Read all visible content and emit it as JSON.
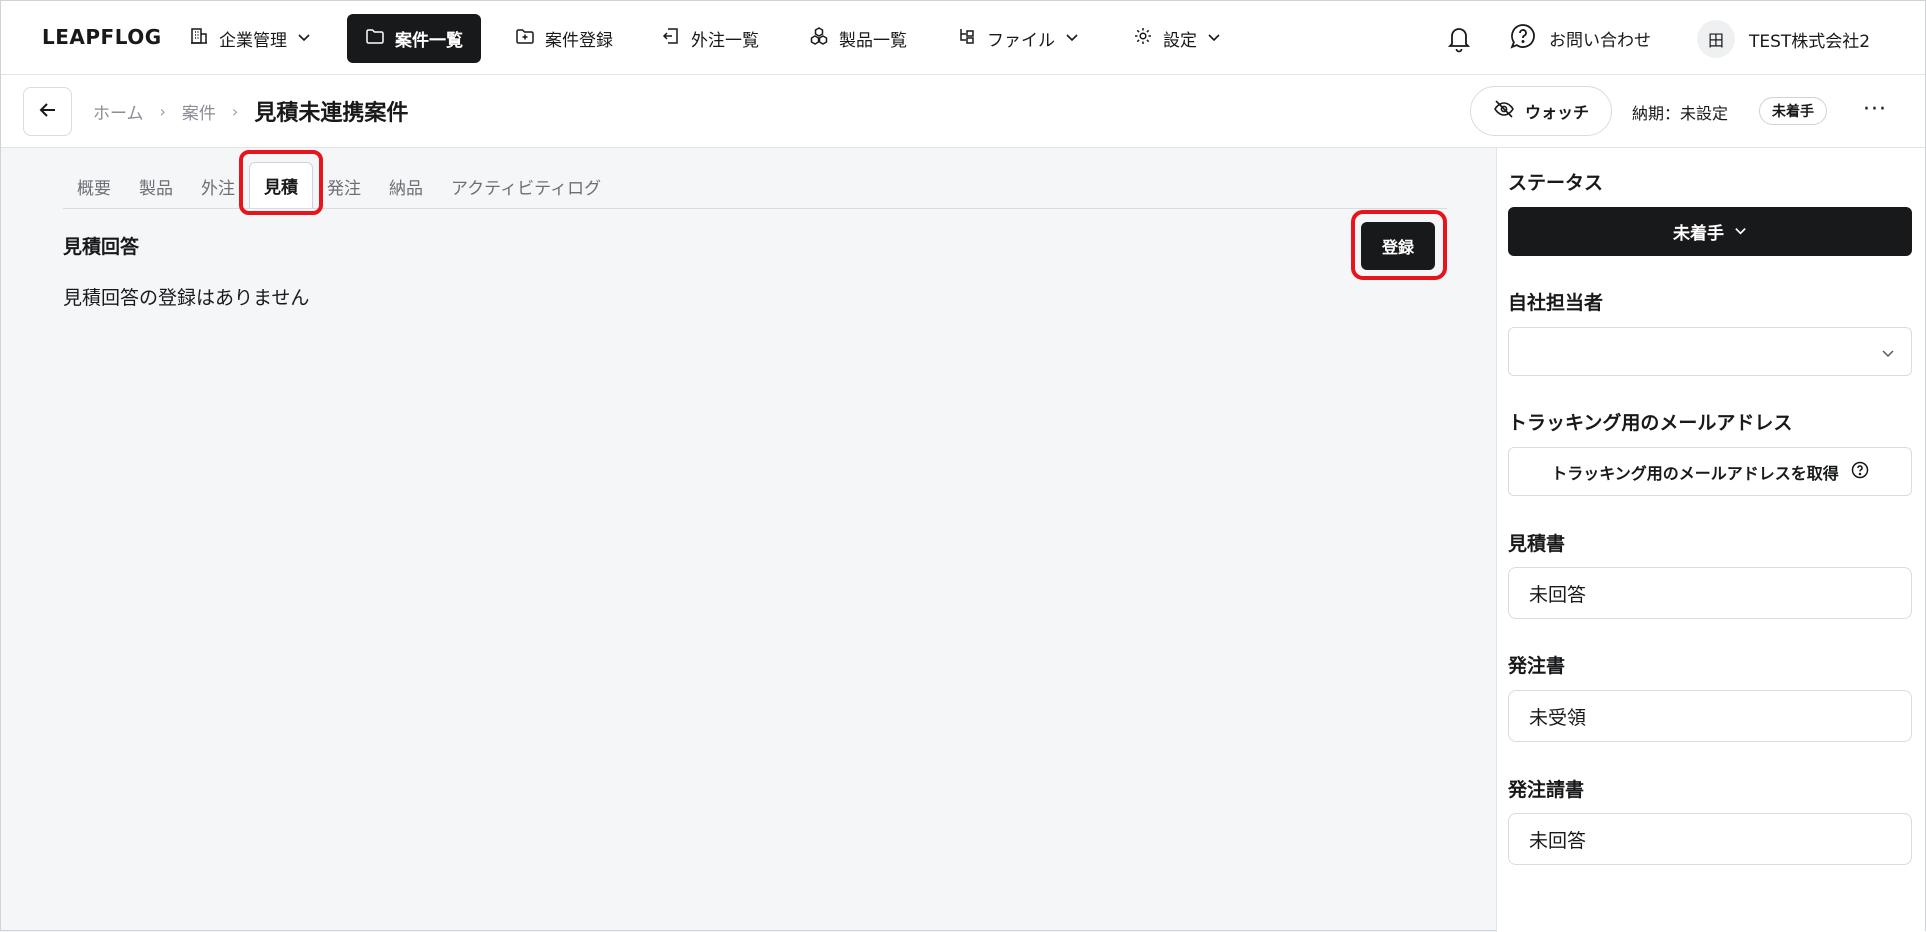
{
  "app": {
    "logo": "LEAPFLOG"
  },
  "nav": {
    "items": [
      {
        "label": "企業管理",
        "icon": "building-icon",
        "has_dropdown": true
      },
      {
        "label": "案件一覧",
        "icon": "folder-icon",
        "active": true
      },
      {
        "label": "案件登録",
        "icon": "folder-plus-icon"
      },
      {
        "label": "外注一覧",
        "icon": "outsource-icon"
      },
      {
        "label": "製品一覧",
        "icon": "boxes-icon"
      },
      {
        "label": "ファイル",
        "icon": "file-tree-icon",
        "has_dropdown": true
      },
      {
        "label": "設定",
        "icon": "gear-icon",
        "has_dropdown": true
      }
    ],
    "contact_label": "お問い合わせ",
    "user": {
      "avatar_text": "田",
      "company": "TEST株式会社2"
    }
  },
  "subheader": {
    "breadcrumb": [
      "ホーム",
      "案件"
    ],
    "current": "見積未連携案件",
    "watch_label": "ウォッチ",
    "due_label": "納期：未設定",
    "status_pill": "未着手",
    "more_label": "···"
  },
  "tabs": [
    {
      "label": "概要"
    },
    {
      "label": "製品"
    },
    {
      "label": "外注"
    },
    {
      "label": "見積",
      "active": true
    },
    {
      "label": "発注"
    },
    {
      "label": "納品"
    },
    {
      "label": "アクティビティログ"
    }
  ],
  "main": {
    "section_title": "見積回答",
    "register_label": "登録",
    "empty_text": "見積回答の登録はありません"
  },
  "side": {
    "status_label": "ステータス",
    "status_value": "未着手",
    "assignee_label": "自社担当者",
    "assignee_value": "",
    "tracking_label": "トラッキング用のメールアドレス",
    "tracking_button": "トラッキング用のメールアドレスを取得",
    "quote_label": "見積書",
    "quote_value": "未回答",
    "po_label": "発注書",
    "po_value": "未受領",
    "invoice_label": "発注請書",
    "invoice_value": "未回答"
  },
  "colors": {
    "primary_dark": "#18191b",
    "highlight_red": "#e6141b",
    "background": "#f5f6f7"
  }
}
